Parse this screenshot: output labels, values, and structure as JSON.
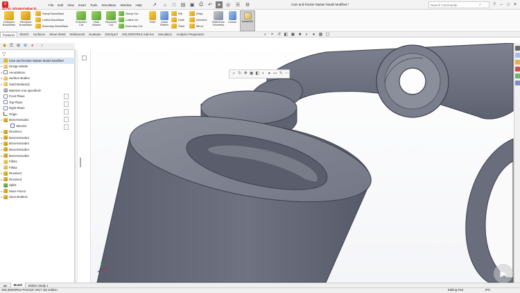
{
  "app": {
    "brand": "SOLIDWORKS",
    "brand_icon": "ds-logo-icon"
  },
  "menu": [
    "File",
    "Edit",
    "View",
    "Insert",
    "Tools",
    "Simulation",
    "Window",
    "Help"
  ],
  "window": {
    "title": "Cam and Rocker Master Model Modified *",
    "search_placeholder": "Search Commands"
  },
  "ribbon": {
    "groups": [
      {
        "label": "Extruded Boss/Base",
        "icon": "extrude-icon"
      },
      {
        "label": "Revolved Boss/Base",
        "icon": "revolve-icon"
      }
    ],
    "small_boss": [
      "Swept Boss/Base",
      "Lofted Boss/Base",
      "Boundary Boss/Base"
    ],
    "cut_groups": [
      {
        "label": "Extruded Cut",
        "icon": "extruded-cut-icon"
      },
      {
        "label": "Hole Wizard",
        "icon": "hole-wizard-icon"
      },
      {
        "label": "Revolved Cut",
        "icon": "revolved-cut-icon"
      }
    ],
    "small_cut": [
      "Swept Cut",
      "Lofted Cut",
      "Boundary Cut"
    ],
    "fillet": "Fillet",
    "linear_pattern": "Linear Pattern",
    "small_fx": [
      "Rib",
      "Draft",
      "Shell"
    ],
    "small_fx2": [
      "Wrap",
      "Intersect",
      "Mirror"
    ],
    "reference": "Reference Geometry",
    "curves": "Curves",
    "instant3d": "Instant3D"
  },
  "tabs": [
    "Features",
    "Sketch",
    "Surfaces",
    "Sheet Metal",
    "Weldments",
    "Evaluate",
    "DimXpert",
    "SOLIDWORKS Add-Ins",
    "Simulation",
    "Analysis Preparation"
  ],
  "active_tab": "Features",
  "tree": [
    {
      "label": "Cam and Rocker Master Model Modified",
      "icon": "part",
      "root": true
    },
    {
      "label": "Design Binder",
      "icon": "folder"
    },
    {
      "label": "Annotations",
      "icon": "annot"
    },
    {
      "label": "Surface Bodies",
      "icon": "folder"
    },
    {
      "label": "Solid Bodies(4)",
      "icon": "folder"
    },
    {
      "label": "Material <not specified>",
      "icon": "material"
    },
    {
      "label": "Front Plane",
      "icon": "plane"
    },
    {
      "label": "Top Plane",
      "icon": "plane"
    },
    {
      "label": "Right Plane",
      "icon": "plane"
    },
    {
      "label": "Origin",
      "icon": "origin"
    },
    {
      "label": "Boss-Extrude1",
      "icon": "feature"
    },
    {
      "label": "Sketch1",
      "icon": "sketch",
      "indent": true
    },
    {
      "label": "Revolve1",
      "icon": "feature"
    },
    {
      "label": "Boss-Extrude2",
      "icon": "feature"
    },
    {
      "label": "Boss-Extrude3",
      "icon": "feature"
    },
    {
      "label": "Boss-Extrude4",
      "icon": "feature"
    },
    {
      "label": "Boss-Extrude5",
      "icon": "feature"
    },
    {
      "label": "Fillet1",
      "icon": "fillet"
    },
    {
      "label": "Fillet2",
      "icon": "fillet"
    },
    {
      "label": "Revolve2",
      "icon": "feature"
    },
    {
      "label": "Revolve3",
      "icon": "feature"
    },
    {
      "label": "Split1",
      "icon": "cut"
    },
    {
      "label": "Move Face2",
      "icon": "feature"
    },
    {
      "label": "Save Bodies1",
      "icon": "feature"
    }
  ],
  "bottom_tabs": [
    "Model",
    "Motion Study 1"
  ],
  "status": {
    "edition": "SOLIDWORKS Premium 2017 x64 Edition",
    "mode": "Editing Part",
    "units": "IPS"
  },
  "colors": {
    "brand": "#d9262c",
    "model": "#6b6f7d",
    "model_dark": "#3f4250"
  }
}
